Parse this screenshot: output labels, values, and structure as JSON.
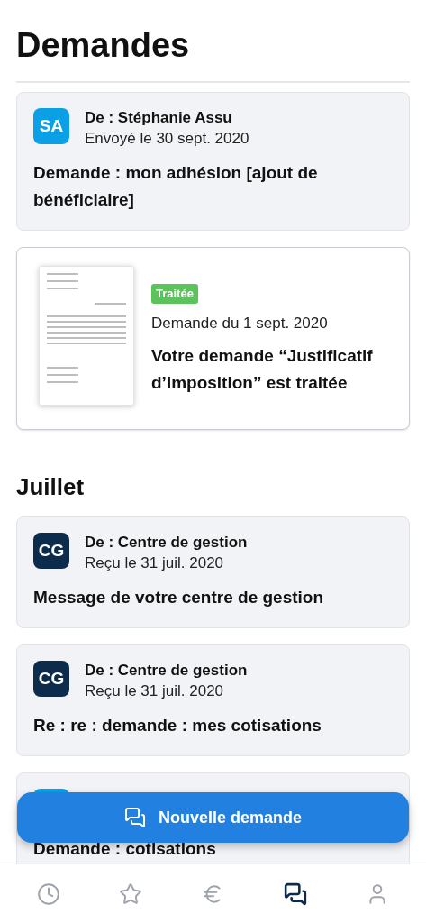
{
  "title": "Demandes",
  "sections": [
    {
      "items": [
        {
          "kind": "message",
          "avatar": {
            "initials": "SA",
            "color": "#0ba0e6"
          },
          "sender": "De : Stéphanie Assu",
          "date": "Envoyé le 30 sept. 2020",
          "subject": "Demande : mon adhésion [ajout de bénéficiaire]"
        },
        {
          "kind": "document",
          "status": "Traitée",
          "date": "Demande du 1 sept. 2020",
          "subject": "Votre demande “Justificatif d’imposition” est traitée"
        }
      ]
    },
    {
      "heading": "Juillet",
      "items": [
        {
          "kind": "message",
          "avatar": {
            "initials": "CG",
            "color": "#0d2b4b"
          },
          "sender": "De : Centre de gestion",
          "date": "Reçu le 31 juil. 2020",
          "subject": "Message de votre centre de gestion"
        },
        {
          "kind": "message",
          "avatar": {
            "initials": "CG",
            "color": "#0d2b4b"
          },
          "sender": "De : Centre de gestion",
          "date": "Reçu le 31 juil. 2020",
          "subject": "Re : re : demande : mes cotisations"
        },
        {
          "kind": "message",
          "avatar": {
            "color": "#0ba0e6"
          },
          "subject": "Demande : cotisations"
        }
      ]
    }
  ],
  "new_request_button": "Nouvelle demande",
  "nav": [
    {
      "kind": "history",
      "selected": false
    },
    {
      "kind": "favorites",
      "selected": false
    },
    {
      "kind": "payments",
      "selected": false
    },
    {
      "kind": "requests",
      "selected": true
    },
    {
      "kind": "profile",
      "selected": false
    }
  ]
}
